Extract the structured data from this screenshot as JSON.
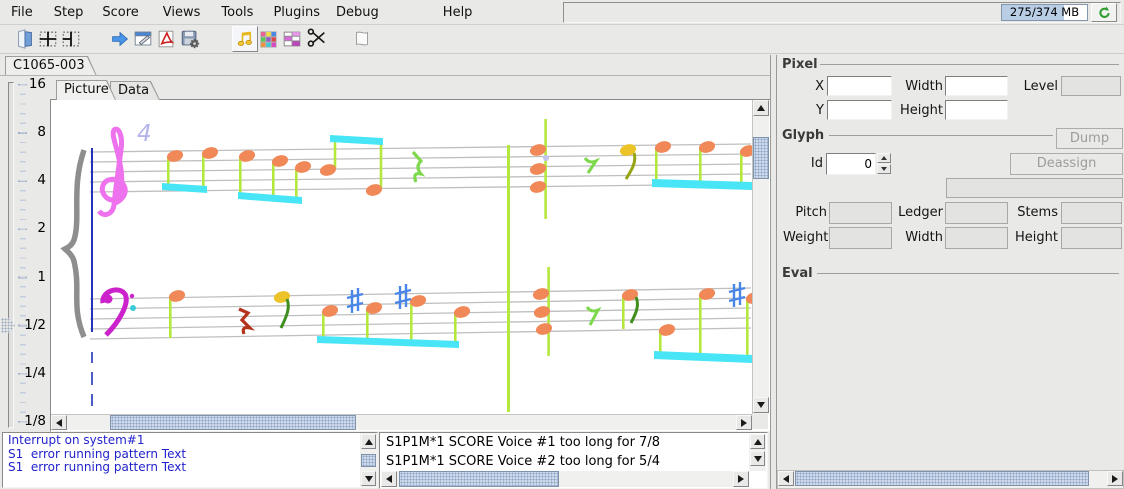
{
  "menu_bar": {
    "items": [
      "File",
      "Step",
      "Score",
      "Views",
      "Tools",
      "Plugins",
      "Debug",
      "Help"
    ],
    "memory_label": "275/374 MB"
  },
  "toolbar": {
    "icons": [
      "exit-door",
      "split-cross",
      "split-vertical",
      "forward-arrow",
      "window-edit",
      "pdf-export",
      "save-settings",
      "music-notes",
      "palette",
      "color-table",
      "scissors",
      "script-page"
    ],
    "active_icon": "music-notes"
  },
  "document_tab": {
    "label": "C1065-003"
  },
  "view_tabs": {
    "picture": "Picture",
    "data": "Data",
    "active": "Picture"
  },
  "zoom_ruler": {
    "labels": [
      "16",
      "8",
      "4",
      "2",
      "1",
      "1/2",
      "1/4",
      "1/8"
    ],
    "handle_position_label": "1/2"
  },
  "score_view": {
    "time_signature": "4",
    "palette": {
      "staff_line": "#bfbfbf",
      "brace": "#8e8e8e",
      "system_barline": "#2233bb",
      "treble_clef": "#ee72ee",
      "bass_clef": "#cc22cc",
      "notehead": "#f08858",
      "stem": "#b5e83c",
      "beam": "#47e5f5",
      "accidental_sharp": "#4a86e8",
      "notehead_yellow": "#edc32a",
      "rest_quarter_red": "#b5331c",
      "rest_green": "#7ed84c",
      "flag_dark_green": "#3f8e1e",
      "time_signature_color": "#b4b4ec"
    }
  },
  "inspector": {
    "pixel": {
      "title": "Pixel",
      "x_label": "X",
      "y_label": "Y",
      "width_label": "Width",
      "height_label": "Height",
      "level_label": "Level"
    },
    "glyph": {
      "title": "Glyph",
      "id_label": "Id",
      "id_value": "0",
      "dump_button": "Dump",
      "deassign_button": "Deassign",
      "pitch_label": "Pitch",
      "ledger_label": "Ledger",
      "stems_label": "Stems",
      "weight_label": "Weight",
      "width_label": "Width",
      "height_label": "Height"
    },
    "eval": {
      "title": "Eval"
    }
  },
  "messages": [
    "Interrupt on system#1",
    "S1  error running pattern Text",
    "S1  error running pattern Text"
  ],
  "issues": [
    "S1P1M*1 SCORE Voice #1 too long for 7/8",
    "S1P1M*1 SCORE Voice #2 too long for 5/4"
  ]
}
